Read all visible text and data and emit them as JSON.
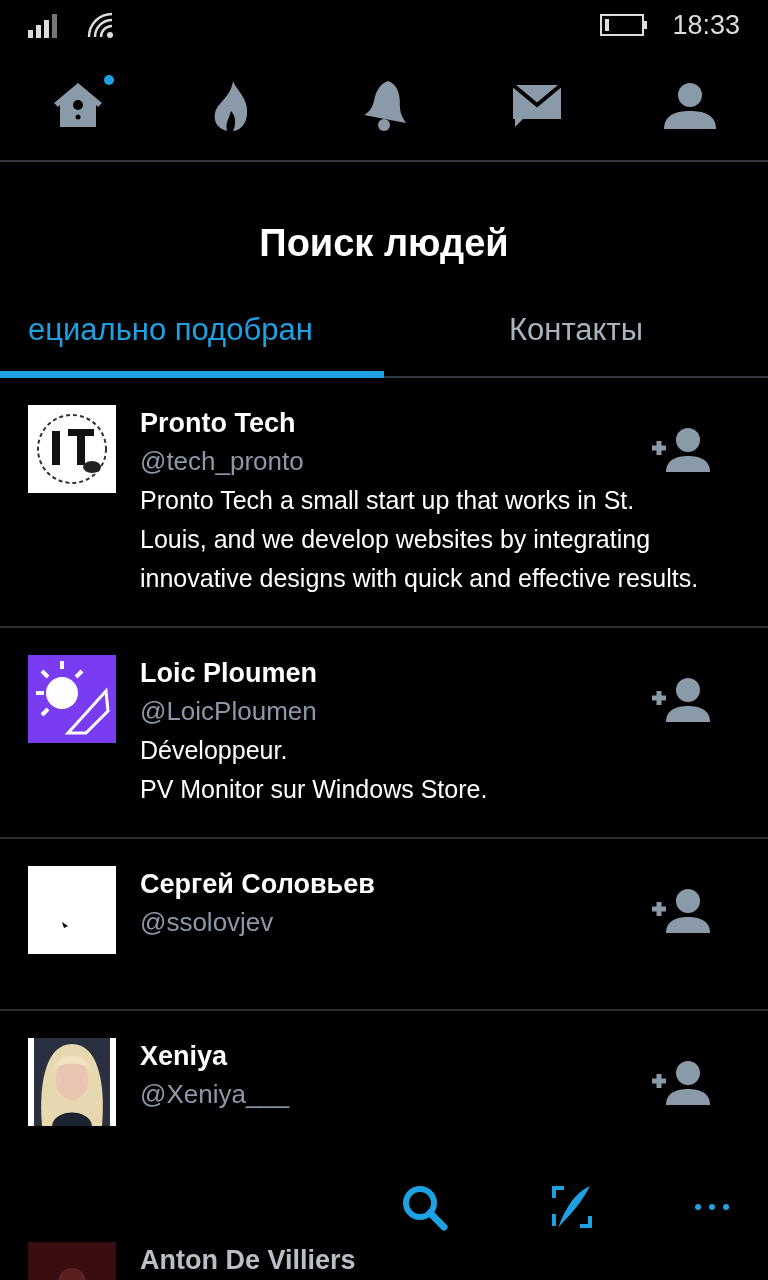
{
  "status_bar": {
    "time": "18:33"
  },
  "nav": [
    {
      "kind": "home",
      "badge": true
    },
    {
      "kind": "fire",
      "badge": false
    },
    {
      "kind": "bell",
      "badge": false
    },
    {
      "kind": "mail",
      "badge": false
    },
    {
      "kind": "person",
      "badge": false
    }
  ],
  "title": "Поиск людей",
  "tabs": [
    {
      "label": "ециально подобран",
      "selected": true
    },
    {
      "label": "Контакты",
      "selected": false
    }
  ],
  "people": [
    {
      "name": "Pronto Tech",
      "handle": "@tech_pronto",
      "bio": "Pronto Tech a small start up that works in St. Louis, and we develop websites by integrating innovative designs with quick and effective results."
    },
    {
      "name": "Loic Ploumen",
      "handle": "@LoicPloumen",
      "bio": "Développeur.\nPV Monitor sur Windows Store."
    },
    {
      "name": "Сергей Соловьев",
      "handle": "@ssolovjev"
    },
    {
      "name": "Xeniya",
      "handle": "@Xeniya___"
    },
    {
      "name": "Anton De Villiers"
    }
  ],
  "app_bar": [
    {
      "kind": "search"
    },
    {
      "kind": "compose"
    },
    {
      "kind": "more"
    }
  ]
}
